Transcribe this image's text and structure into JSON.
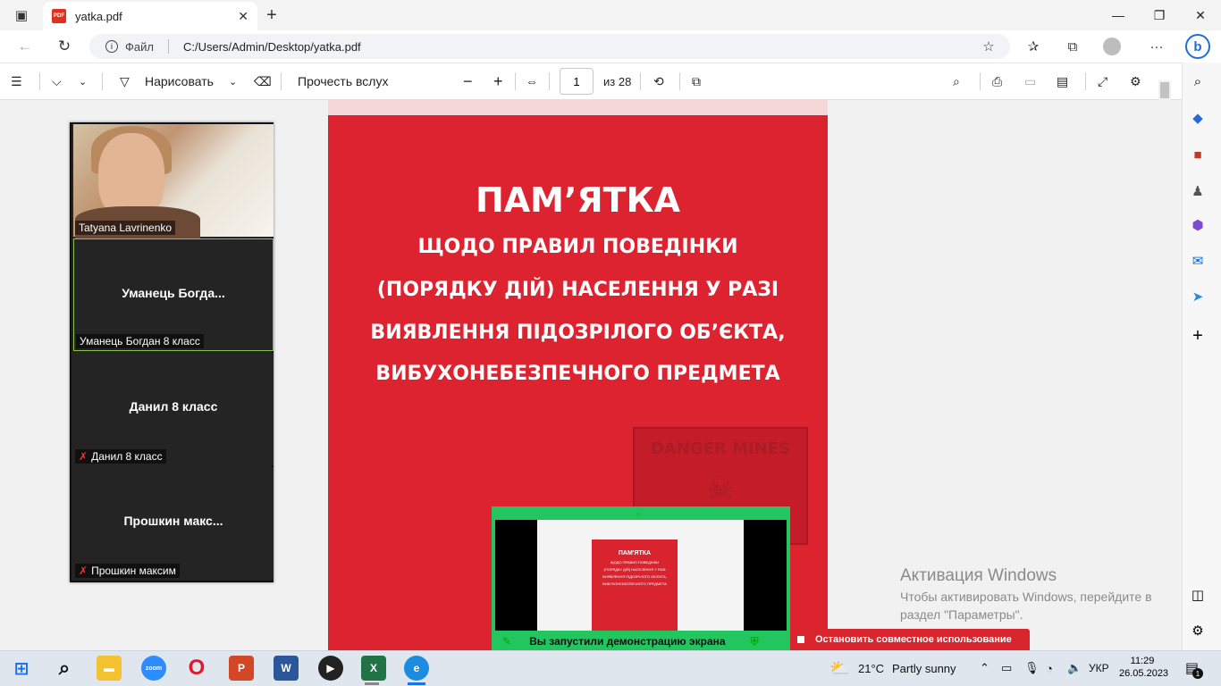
{
  "browser": {
    "tab_title": "yatka.pdf",
    "tab_close": "✕",
    "new_tab": "+",
    "address_scheme": "Файл",
    "address_url": "C:/Users/Admin/Desktop/yatka.pdf"
  },
  "pdf_toolbar": {
    "draw_label": "Нарисовать",
    "read_aloud_label": "Прочесть вслух",
    "zoom_out": "−",
    "zoom_in": "+",
    "page_current": "1",
    "page_total": "из 28"
  },
  "document": {
    "title": "ПАМ’ЯТКА",
    "lines": [
      "ЩОДО ПРАВИЛ ПОВЕДІНКИ",
      "(ПОРЯДКУ ДІЙ) НАСЕЛЕННЯ У РАЗІ",
      "ВИЯВЛЕННЯ ПІДОЗРІЛОГО ОБ’ЄКТА,",
      "ВИБУХОНЕБЕЗПЕЧНОГО ПРЕДМЕТА"
    ],
    "sign_text": "DANGER MINES"
  },
  "zoom": {
    "participants": [
      {
        "tile_name": "",
        "label": "Tatyana Lavrinenko",
        "muted": false
      },
      {
        "tile_name": "Уманець  Богда...",
        "label": "Уманець Богдан 8 класс",
        "muted": false
      },
      {
        "tile_name": "Данил 8 класс",
        "label": "Данил 8 класс",
        "muted": true
      },
      {
        "tile_name": "Прошкин  макс...",
        "label": "Прошкин максим",
        "muted": true
      }
    ],
    "share_status": "Вы запустили демонстрацию экрана",
    "stop_share": "Остановить совместное использование",
    "mini_title": "ПАМ'ЯТКА",
    "mini_lines": [
      "ЩОДО ПРАВИЛ ПОВЕДІНКИ",
      "(ПОРЯДКУ ДІЙ) НАСЕЛЕННЯ У РАЗІ",
      "ВИЯВЛЕННЯ ПІДОЗРІЛОГО ОБ'ЄКТА,",
      "ВИБУХОНЕБЕЗПЕЧНОГО ПРЕДМЕТА"
    ]
  },
  "activation": {
    "title": "Активация Windows",
    "line1": "Чтобы активировать Windows, перейдите в",
    "line2": "раздел \"Параметры\"."
  },
  "taskbar": {
    "weather_temp": "21°C",
    "weather_desc": "Partly sunny",
    "language": "УКР",
    "time": "11:29",
    "date": "26.05.2023",
    "notification_count": "1",
    "zoom_app_label": "zoom"
  }
}
